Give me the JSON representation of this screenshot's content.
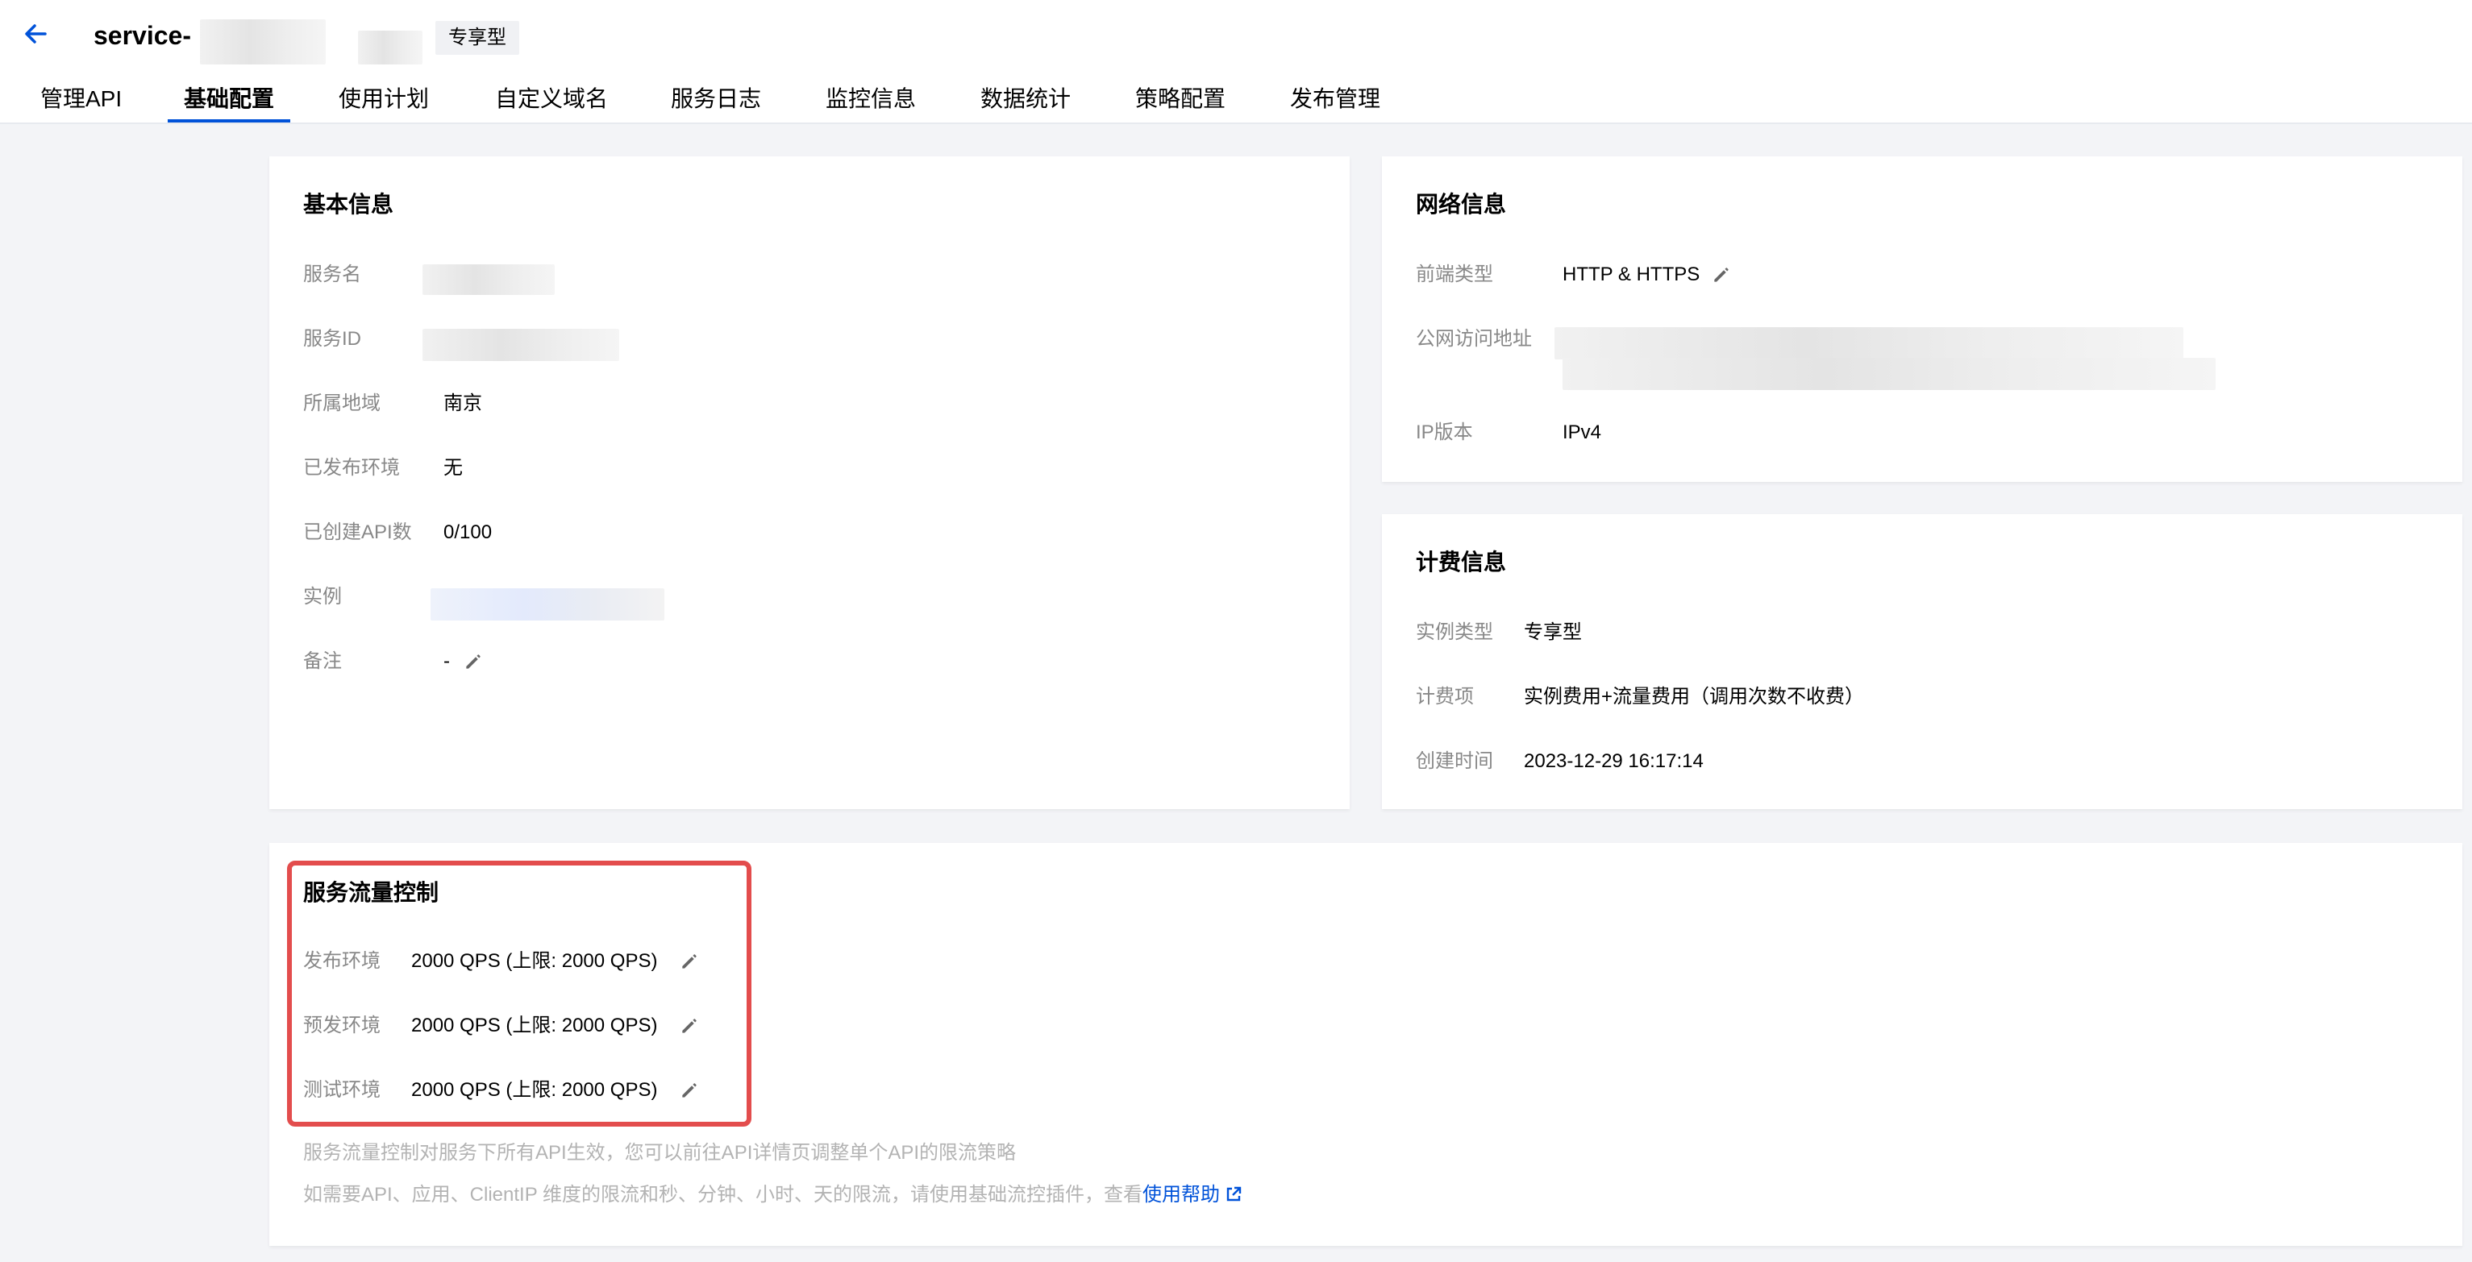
{
  "header": {
    "service_title": "service-",
    "instance_badge": "专享型"
  },
  "tabs": [
    {
      "label": "管理API"
    },
    {
      "label": "基础配置"
    },
    {
      "label": "使用计划"
    },
    {
      "label": "自定义域名"
    },
    {
      "label": "服务日志"
    },
    {
      "label": "监控信息"
    },
    {
      "label": "数据统计"
    },
    {
      "label": "策略配置"
    },
    {
      "label": "发布管理"
    }
  ],
  "active_tab": "基础配置",
  "basic_info": {
    "title": "基本信息",
    "service_name_label": "服务名",
    "service_id_label": "服务ID",
    "region_label": "所属地域",
    "region_value": "南京",
    "published_env_label": "已发布环境",
    "published_env_value": "无",
    "api_count_label": "已创建API数",
    "api_count_value": "0/100",
    "instance_label": "实例",
    "remark_label": "备注",
    "remark_value": "-"
  },
  "network_info": {
    "title": "网络信息",
    "frontend_type_label": "前端类型",
    "frontend_type_value": "HTTP & HTTPS",
    "public_address_label": "公网访问地址",
    "ip_version_label": "IP版本",
    "ip_version_value": "IPv4"
  },
  "billing_info": {
    "title": "计费信息",
    "instance_type_label": "实例类型",
    "instance_type_value": "专享型",
    "billing_item_label": "计费项",
    "billing_item_value": "实例费用+流量费用（调用次数不收费）",
    "created_time_label": "创建时间",
    "created_time_value": "2023-12-29 16:17:14"
  },
  "traffic_control": {
    "title": "服务流量控制",
    "rows": [
      {
        "label": "发布环境",
        "value": "2000 QPS (上限: 2000 QPS)"
      },
      {
        "label": "预发环境",
        "value": "2000 QPS (上限: 2000 QPS)"
      },
      {
        "label": "测试环境",
        "value": "2000 QPS (上限: 2000 QPS)"
      }
    ],
    "note_1": "服务流量控制对服务下所有API生效，您可以前往API详情页调整单个API的限流策略",
    "note_2_prefix": "如需要API、应用、ClientIP 维度的限流和秒、分钟、小时、天的限流，请使用基础流控插件，查看",
    "help_link": "使用帮助"
  },
  "colors": {
    "accent": "#0052d9",
    "highlight": "#e34d4d",
    "label_gray": "#888888",
    "note_gray": "#b3b3b3",
    "page_bg": "#f3f4f7"
  },
  "icons": {
    "back": "arrow-left-icon",
    "edit": "pencil-icon",
    "external": "external-link-icon"
  }
}
